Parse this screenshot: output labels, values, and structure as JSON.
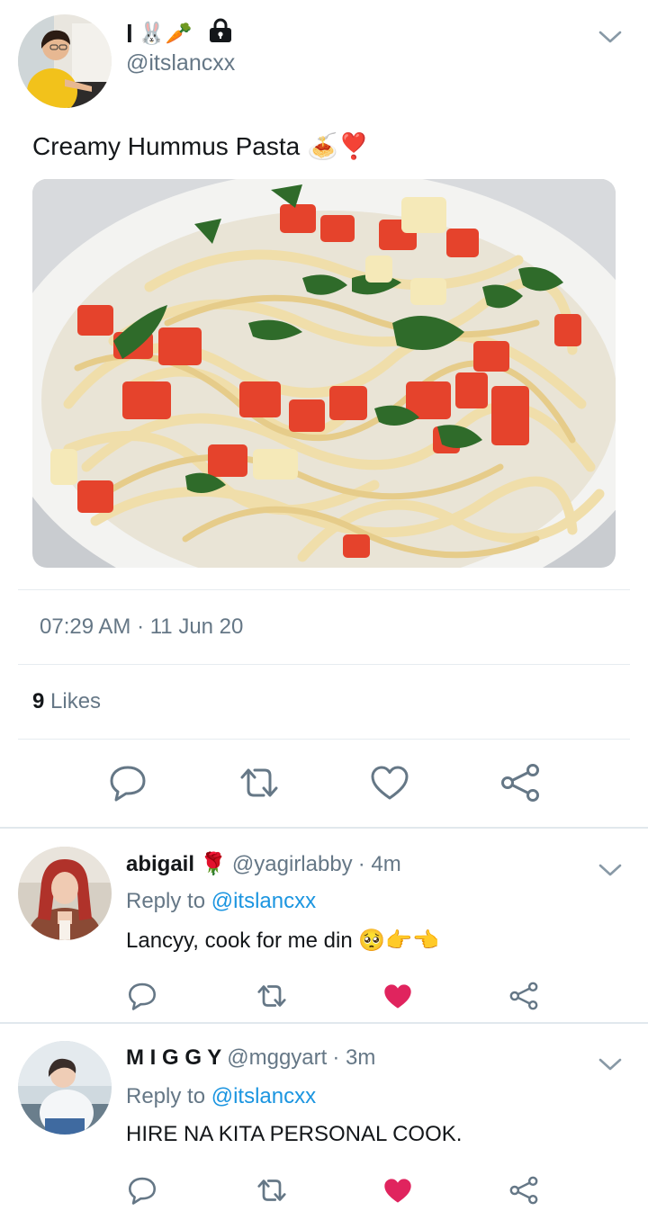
{
  "tweet": {
    "author_name": "l",
    "author_name_emoji": "🐰🥕",
    "locked_icon": "lock-icon",
    "handle": "@itslancxx",
    "text": "Creamy Hummus Pasta 🍝❣️",
    "timestamp": "07:29 AM · 11 Jun 20",
    "likes_count": "9",
    "likes_label": "Likes"
  },
  "replies": [
    {
      "name": "abigail",
      "name_emoji": "🌹",
      "handle": "@yagirlabby",
      "age": "· 4m",
      "reply_to_label": "Reply to",
      "reply_to_handle": "@itslancxx",
      "text": "Lancyy, cook for me din 🥺👉👈",
      "liked": true
    },
    {
      "name": "M I G G Y",
      "name_emoji": "",
      "handle": "@mggyart",
      "age": "· 3m",
      "reply_to_label": "Reply to",
      "reply_to_handle": "@itslancxx",
      "text": "HIRE NA KITA PERSONAL COOK.",
      "liked": true
    }
  ],
  "colors": {
    "icon_gray": "#657786",
    "like_red": "#e0245e",
    "link_blue": "#1b95e0"
  },
  "icons": [
    "chevron-down-icon",
    "reply-icon",
    "retweet-icon",
    "like-icon",
    "share-icon"
  ]
}
